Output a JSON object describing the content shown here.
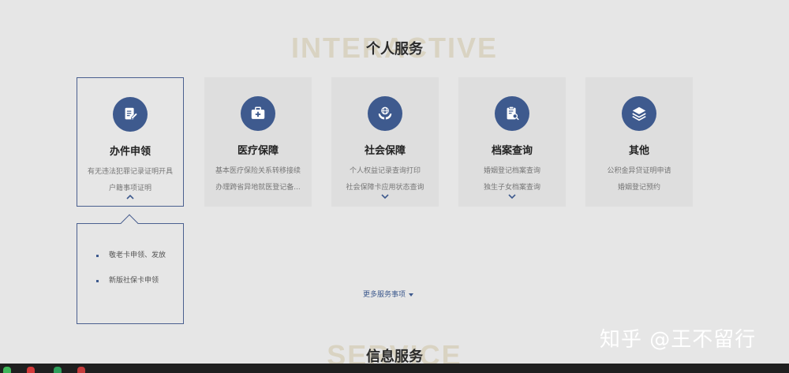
{
  "sections": {
    "personal": {
      "bg_word": "INTERACTIVE",
      "title": "个人服务"
    },
    "info": {
      "bg_word": "SERVICE",
      "title": "信息服务"
    }
  },
  "cards": [
    {
      "title": "办件申领",
      "icon": "edit-document-icon",
      "lines": [
        "有无违法犯罪记录证明开具",
        "户籍事项证明"
      ],
      "active": true
    },
    {
      "title": "医疗保障",
      "icon": "medical-kit-icon",
      "lines": [
        "基本医疗保险关系转移接续",
        "办理跨省异地就医登记备..."
      ],
      "active": false
    },
    {
      "title": "社会保障",
      "icon": "globe-hands-icon",
      "lines": [
        "个人权益记录查询打印",
        "社会保障卡应用状态查询"
      ],
      "active": false
    },
    {
      "title": "档案查询",
      "icon": "clipboard-search-icon",
      "lines": [
        "婚姻登记档案查询",
        "独生子女档案查询"
      ],
      "active": false
    },
    {
      "title": "其他",
      "icon": "layers-icon",
      "lines": [
        "公积金异贷证明申请",
        "婚姻登记预约"
      ],
      "active": false
    }
  ],
  "dropdown": {
    "items": [
      "敬老卡申领、发放",
      "新版社保卡申领"
    ]
  },
  "more_link": {
    "label": "更多服务事项"
  },
  "watermark": "知乎 @王不留行",
  "colors": {
    "accent": "#3e5a8e",
    "background": "#e6e6e6",
    "card": "#dedede"
  }
}
